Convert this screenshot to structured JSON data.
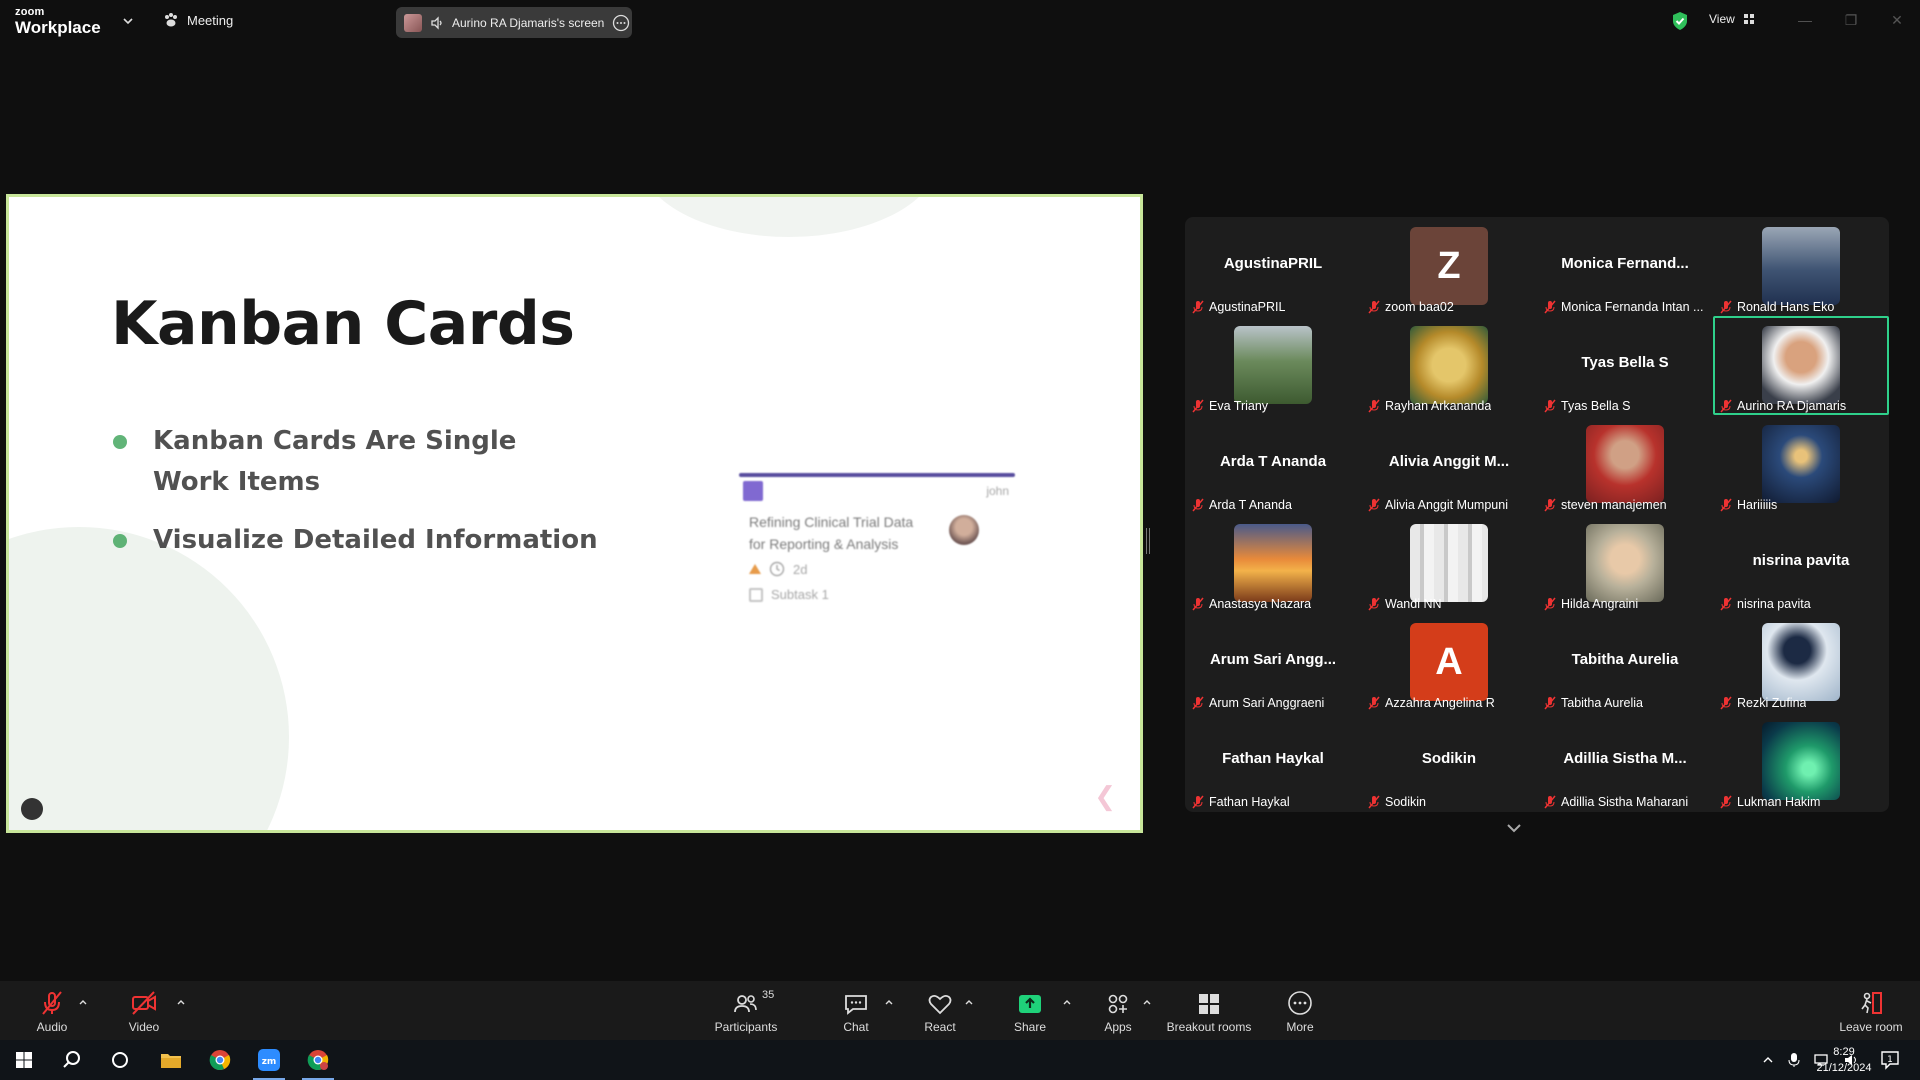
{
  "titlebar": {
    "brand_top": "zoom",
    "brand_bottom": "Workplace",
    "meeting_label": "Meeting",
    "screen_share_label": "Aurino RA Djamaris's screen",
    "view_label": "View",
    "accent_color": "#2fd08b"
  },
  "slide": {
    "title": "Kanban Cards",
    "bullets": [
      "Kanban Cards Are Single",
      "Work Items",
      "Visualize Detailed Information"
    ],
    "card": {
      "owner": "john",
      "text": "Refining Clinical Trial Data for Reporting & Analysis",
      "due": "2d",
      "subtask": "Subtask 1"
    }
  },
  "gallery": {
    "tiles": [
      {
        "label": "AgustinaPRIL",
        "center": "AgustinaPRIL"
      },
      {
        "label": "zoom baa02",
        "letter": "Z",
        "color": "#6b4439"
      },
      {
        "label": "Monica Fernanda Intan ...",
        "center": "Monica  Fernand..."
      },
      {
        "label": "Ronald Hans Eko",
        "photo": "ronald"
      },
      {
        "label": "Eva Triany",
        "photo": "eva"
      },
      {
        "label": "Rayhan Arkananda",
        "photo": "rayhan"
      },
      {
        "label": "Tyas Bella S",
        "center": "Tyas Bella S"
      },
      {
        "label": "Aurino RA Djamaris",
        "photo": "aurino",
        "active": true
      },
      {
        "label": "Arda T Ananda",
        "center": "Arda T Ananda"
      },
      {
        "label": "Alivia Anggit Mumpuni",
        "center": "Alivia  Anggit  M..."
      },
      {
        "label": "steven manajemen",
        "photo": "steven"
      },
      {
        "label": "Hariiiiis",
        "photo": "hariis"
      },
      {
        "label": "Anastasya Nazara",
        "photo": "anastasya"
      },
      {
        "label": "Wandi NN",
        "photo": "wandi"
      },
      {
        "label": "Hilda Angraini",
        "photo": "hilda"
      },
      {
        "label": "nisrina pavita",
        "center": "nisrina pavita"
      },
      {
        "label": "Arum Sari Anggraeni",
        "center": "Arum  Sari  Angg..."
      },
      {
        "label": "Azzahra Angelina R",
        "letter": "A",
        "color": "#d43d1a"
      },
      {
        "label": "Tabitha Aurelia",
        "center": "Tabitha Aurelia"
      },
      {
        "label": "Rezki Zufina",
        "photo": "rezki"
      },
      {
        "label": "Fathan Haykal",
        "center": "Fathan Haykal"
      },
      {
        "label": "Sodikin",
        "center": "Sodikin"
      },
      {
        "label": "Adillia Sistha Maharani",
        "center": "Adillia  Sistha  M..."
      },
      {
        "label": "Lukman Hakim",
        "photo": "lukman"
      }
    ]
  },
  "toolbar": {
    "audio": "Audio",
    "video": "Video",
    "participants": "Participants",
    "participant_count": "35",
    "chat": "Chat",
    "react": "React",
    "share": "Share",
    "apps": "Apps",
    "breakout": "Breakout rooms",
    "more": "More",
    "leave": "Leave room"
  },
  "taskbar": {
    "time": "8:29",
    "date": "21/12/2024",
    "notification_count": "1"
  }
}
